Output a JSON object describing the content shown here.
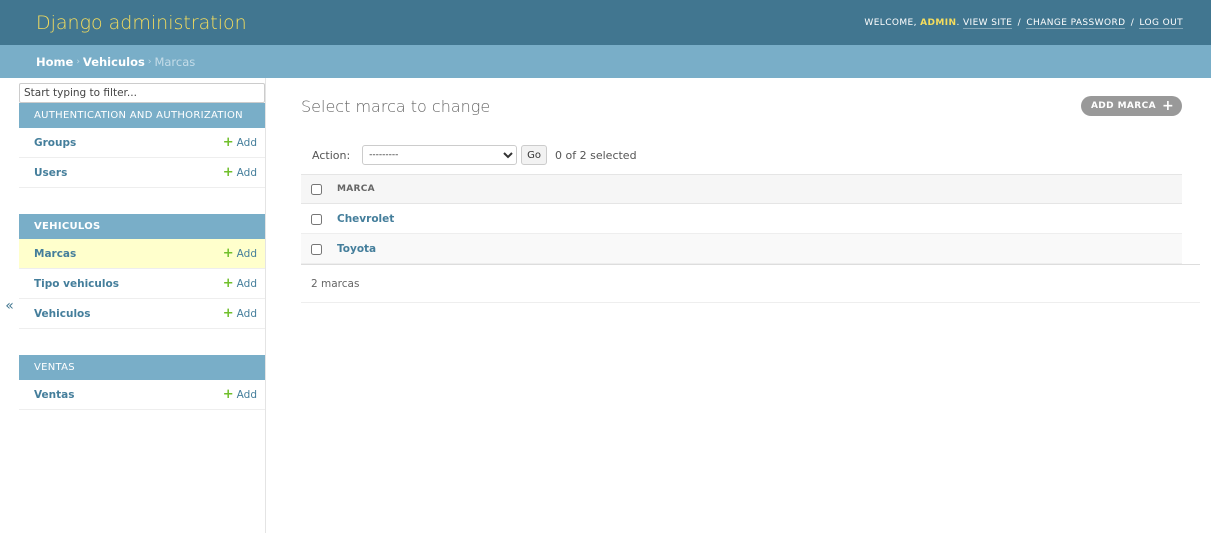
{
  "header": {
    "site_name": "Django administration",
    "welcome": "Welcome, ",
    "username": "admin",
    "after_user": ".",
    "view_site": "View site",
    "change_password": "Change password",
    "log_out": "Log out",
    "separator": "/"
  },
  "breadcrumbs": {
    "home": "Home",
    "app": "Vehiculos",
    "current": "Marcas",
    "separator": "›"
  },
  "sidebar": {
    "toggle_glyph": "«",
    "filter_placeholder": "Start typing to filter...",
    "add_label": "Add",
    "add_glyph": "+",
    "modules": [
      {
        "caption": "Authentication and Authorization",
        "models": [
          "Groups",
          "Users"
        ]
      },
      {
        "caption": "Vehiculos",
        "models": [
          "Marcas",
          "Tipo vehiculos",
          "Vehiculos"
        ],
        "current_model": "Marcas"
      },
      {
        "caption": "Ventas",
        "models": [
          "Ventas"
        ]
      }
    ],
    "m0": {
      "caption": "Authentication and Authorization",
      "groups": "Groups",
      "users": "Users"
    },
    "m1": {
      "caption": "Vehiculos",
      "marcas": "Marcas",
      "tipo": "Tipo vehiculos",
      "vehiculos": "Vehiculos"
    },
    "m2": {
      "caption": "Ventas",
      "ventas": "Ventas"
    }
  },
  "content": {
    "title": "Select marca to change",
    "add_button": "Add marca",
    "add_glyph": "+",
    "actions": {
      "label": "Action:",
      "selected_option": "---------",
      "go_label": "Go",
      "selected_count": "0 of 2 selected"
    },
    "table": {
      "column_header": "Marca",
      "rows": [
        "Chevrolet",
        "Toyota"
      ],
      "row0": "Chevrolet",
      "row1": "Toyota"
    },
    "paginator": "2 marcas"
  },
  "colors": {
    "header_bg": "#417690",
    "breadcrumb_bg": "#79aec8",
    "accent_yellow": "#f5dd5d",
    "link": "#447e9b",
    "add_green": "#70bf2b",
    "current_row_bg": "#ffffcc"
  }
}
